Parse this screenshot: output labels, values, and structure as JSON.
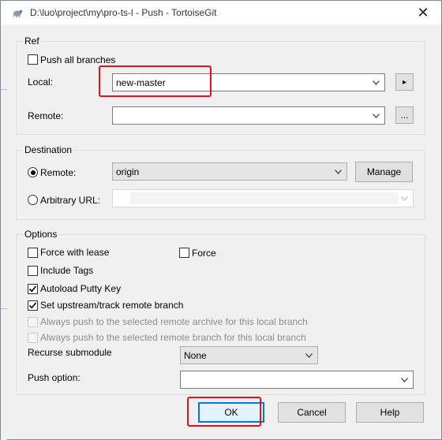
{
  "window": {
    "title": "D:\\luo\\project\\my\\pro-ts-l - Push - TortoiseGit",
    "app_icon": "tortoisegit-icon",
    "close_glyph": "✕"
  },
  "ref": {
    "group_label": "Ref",
    "push_all_branches": {
      "label": "Push all branches",
      "checked": false
    },
    "local": {
      "label": "Local:",
      "value": "new-master"
    },
    "local_browse_glyph": "▸",
    "remote": {
      "label": "Remote:",
      "value": ""
    },
    "remote_browse_label": "..."
  },
  "destination": {
    "group_label": "Destination",
    "remote_radio": {
      "label": "Remote:",
      "selected": true,
      "value": "origin"
    },
    "manage_label": "Manage",
    "arbitrary_url": {
      "label": "Arbitrary URL:",
      "selected": false,
      "value": ""
    }
  },
  "options": {
    "group_label": "Options",
    "force_with_lease": {
      "label": "Force with lease",
      "checked": false
    },
    "force": {
      "label": "Force",
      "checked": false
    },
    "include_tags": {
      "label": "Include Tags",
      "checked": false
    },
    "autoload_putty_key": {
      "label": "Autoload Putty Key",
      "checked": true
    },
    "set_upstream": {
      "label": "Set upstream/track remote branch",
      "checked": true
    },
    "always_push_archive": {
      "label": "Always push to the selected remote archive for this local branch",
      "checked": false,
      "enabled": false
    },
    "always_push_branch": {
      "label": "Always push to the selected remote branch for this local branch",
      "checked": false,
      "enabled": false
    },
    "recurse_submodule": {
      "label": "Recurse submodule",
      "value": "None"
    },
    "push_option": {
      "label": "Push option:",
      "value": ""
    }
  },
  "buttons": {
    "ok": "OK",
    "cancel": "Cancel",
    "help": "Help"
  },
  "colors": {
    "highlight": "#e8101b",
    "default_button_border": "#0078d7"
  }
}
